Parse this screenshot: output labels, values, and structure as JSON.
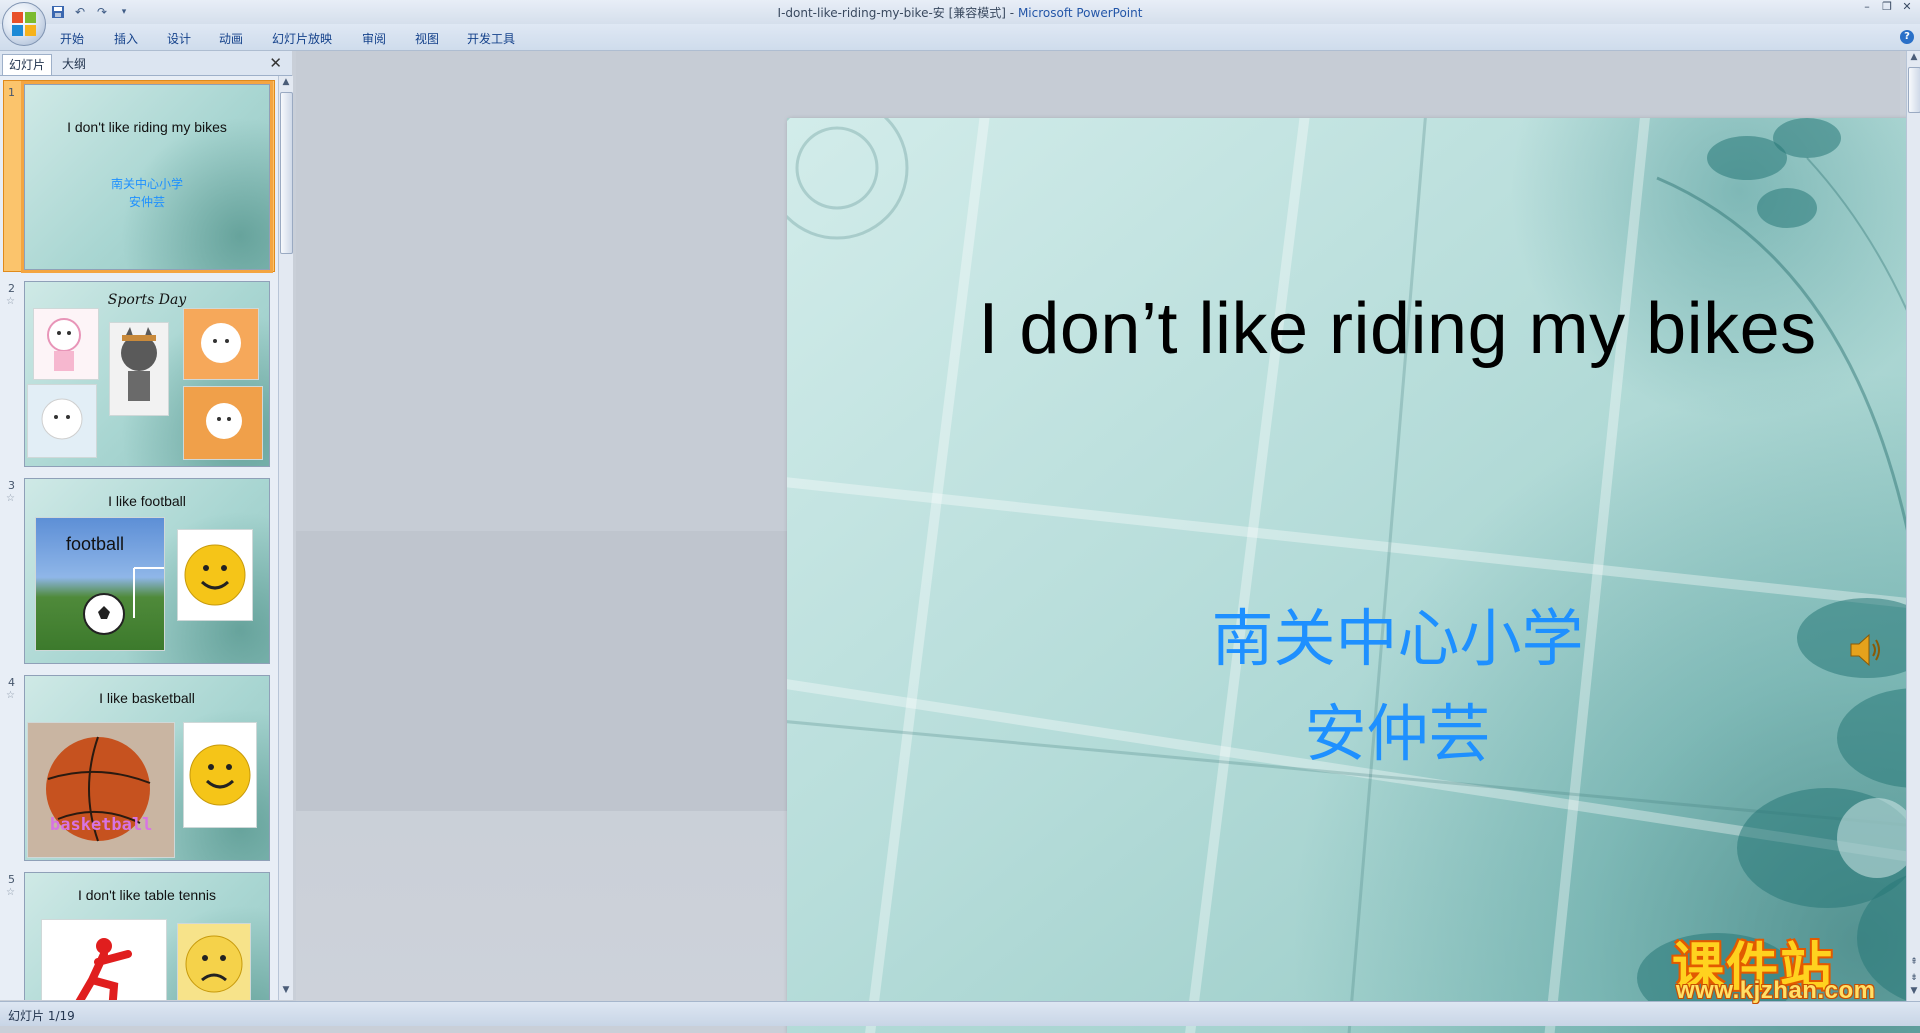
{
  "window": {
    "title": "I-dont-like-riding-my-bike-安 [兼容模式]",
    "separator": " - ",
    "app_name": "Microsoft PowerPoint"
  },
  "ribbon": {
    "tabs": [
      "开始",
      "插入",
      "设计",
      "动画",
      "幻灯片放映",
      "审阅",
      "视图",
      "开发工具"
    ]
  },
  "pane": {
    "tabs": [
      "幻灯片",
      "大纲"
    ],
    "close_glyph": "✕"
  },
  "thumbnails": [
    {
      "num": "1",
      "title": "I  don't like riding my bikes",
      "sub1": "南关中心小学",
      "sub2": "安仲芸"
    },
    {
      "num": "2",
      "title": "Sports  Day"
    },
    {
      "num": "3",
      "title": "I like football",
      "pic_label": "football"
    },
    {
      "num": "4",
      "title": "I like basketball",
      "pic_label": "basketball"
    },
    {
      "num": "5",
      "title": "I don't like table tennis"
    }
  ],
  "slide": {
    "title": "I  don’t like riding my bikes",
    "line1": "南关中心小学",
    "line2": "安仲芸"
  },
  "status": {
    "text": "幻灯片 1/19"
  },
  "watermark": {
    "text": "课件站",
    "url": "www.kjzhan.com"
  },
  "icons": {
    "office": "office-button-icon",
    "save": "save-icon",
    "undo": "undo-icon",
    "redo": "redo-icon",
    "speaker": "speaker-icon",
    "help": "help-icon"
  },
  "colors": {
    "accent": "#1e90ff",
    "selection": "#f4a541"
  }
}
